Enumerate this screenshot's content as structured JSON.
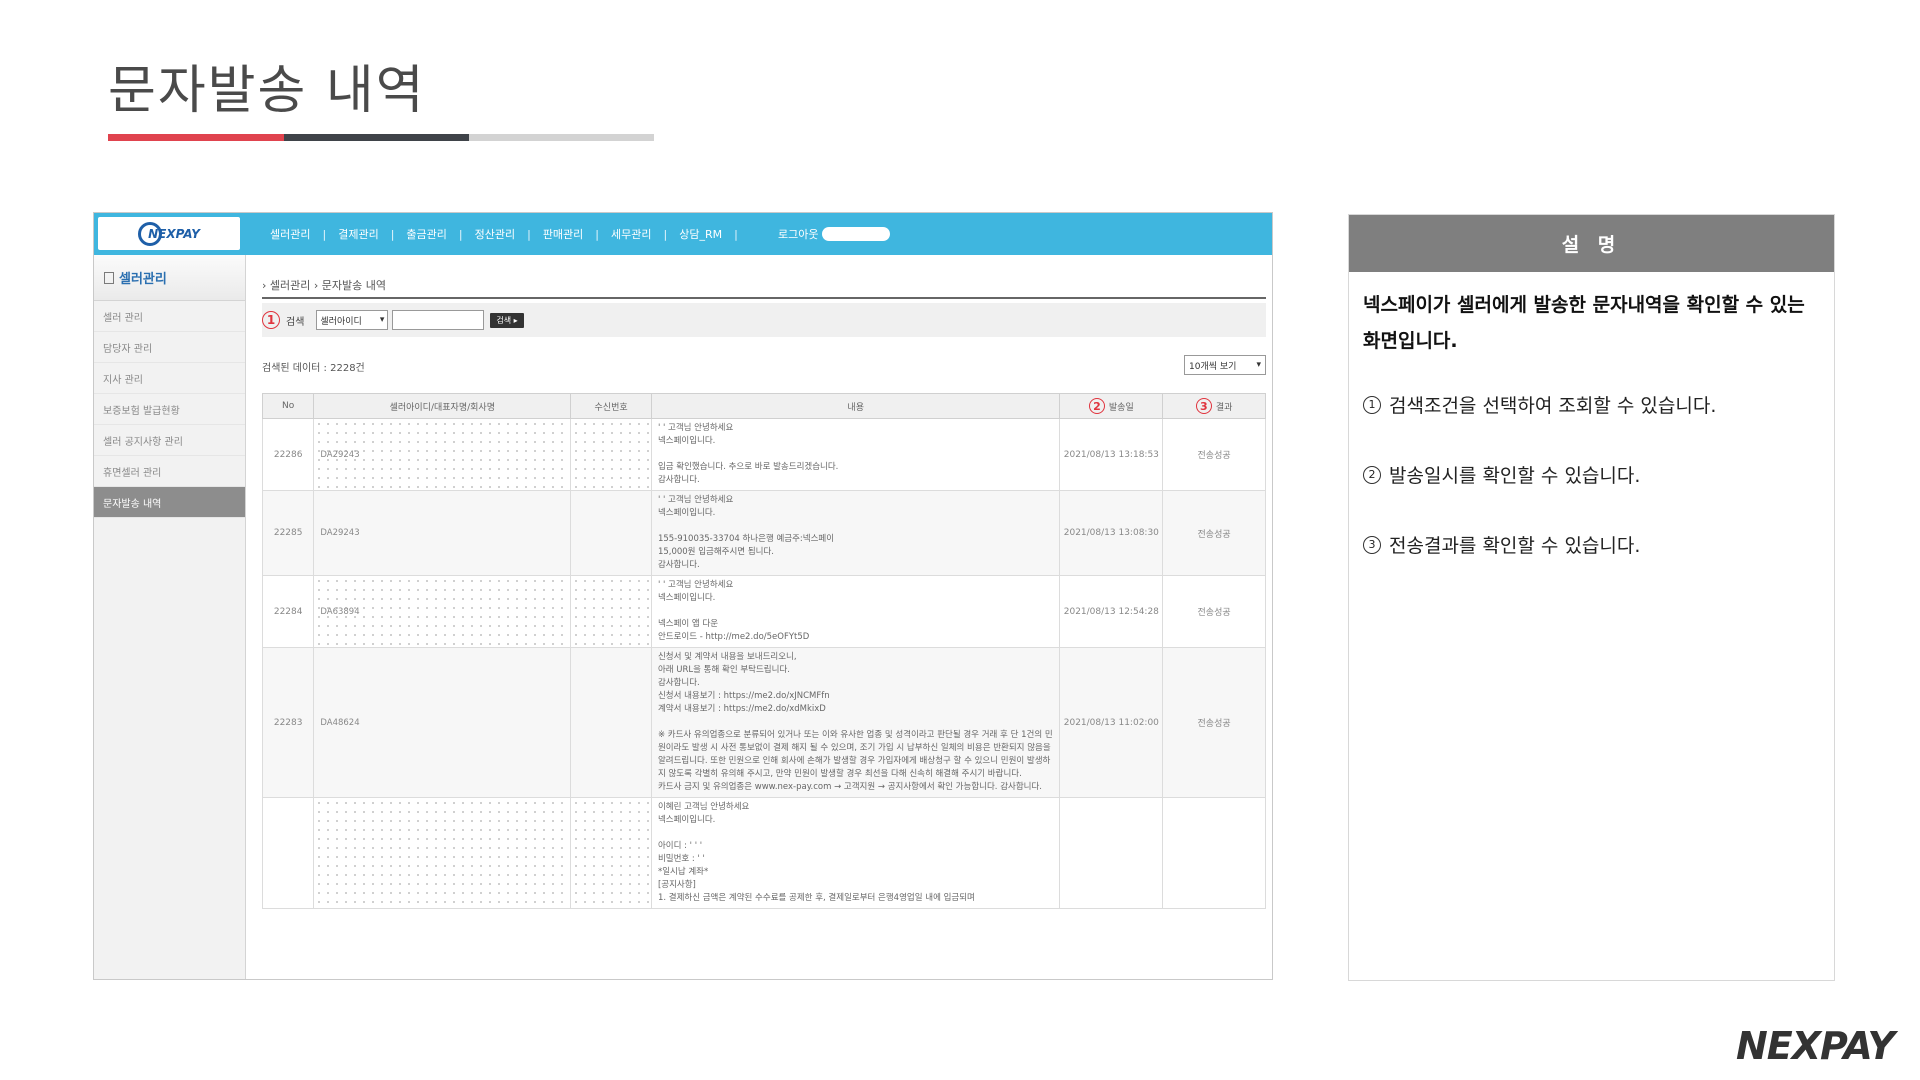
{
  "page": {
    "title": "문자발송 내역",
    "brand": "NEXPAY"
  },
  "app": {
    "logo_text": "NEXPAY",
    "nav": [
      "셀러관리",
      "결제관리",
      "출금관리",
      "정산관리",
      "판매관리",
      "세무관리",
      "상담_RM"
    ],
    "nav_separator": "|",
    "logout_label": "로그아웃"
  },
  "sidebar": {
    "header": "셀러관리",
    "items": [
      "셀러 관리",
      "담당자 관리",
      "지사 관리",
      "보증보험 발급현황",
      "셀러 공지사항 관리",
      "휴면셀러 관리",
      "문자발송 내역"
    ],
    "active_index": 6
  },
  "content": {
    "breadcrumb": "› 셀러관리 › 문자발송 내역",
    "search": {
      "marker": "1",
      "label": "검색",
      "select_value": "셀러아이디",
      "input_value": "",
      "button_label": "검색 ▸"
    },
    "result_count": "검색된 데이터 : 2228건",
    "per_page": "10개씩 보기",
    "table": {
      "columns": [
        "No",
        "셀러아이디/대표자명/회사명",
        "수신번호",
        "내용",
        "발송일",
        "결과"
      ],
      "date_marker": "2",
      "result_marker": "3",
      "rows": [
        {
          "no": "22286",
          "seller": "DA29243",
          "message": "' ' 고객님 안녕하세요\n넥스페이입니다.\n\n입금 확인했습니다. 추으로 바로 발송드리겠습니다.\n감사합니다.",
          "date": "2021/08/13 13:18:53",
          "result": "전송성공"
        },
        {
          "no": "22285",
          "seller": "DA29243",
          "message": "' ' 고객님 안녕하세요\n넥스페이입니다.\n\n155-910035-33704 하나은행 예금주:넥스페이\n15,000원 입금해주시면 됩니다.\n감사합니다.",
          "date": "2021/08/13 13:08:30",
          "result": "전송성공"
        },
        {
          "no": "22284",
          "seller": "DA63894",
          "message": "' ' 고객님 안녕하세요\n넥스페이입니다.\n\n넥스페이 앱 다운\n안드로이드 - http://me2.do/5eOFYt5D",
          "date": "2021/08/13 12:54:28",
          "result": "전송성공"
        },
        {
          "no": "22283",
          "seller": "DA48624",
          "message": "신청서 및 계약서 내용을 보내드리오니,\n아래 URL을 통해 확인 부탁드립니다.\n감사합니다.\n신청서 내용보기 : https://me2.do/xJNCMFfn\n계약서 내용보기 : https://me2.do/xdMkixD\n\n※ 카드사 유의업종으로 분류되어 있거나 또는 이와 유사한 업종 및 성격이라고 판단될 경우 거래 후 단 1건의 민원이라도 발생 시 사전 통보없이 결제 해지 될 수 있으며, 조기 가입 시 납부하신 일체의 비용은 반환되지 않음을 알려드립니다. 또한 민원으로 인해 회사에 손해가 발생할 경우 가입자에게 배상청구 할 수 있으니 민원이 발생하지 않도록 각별히 유의해 주시고, 만약 민원이 발생할 경우 최선을 다해 신속히 해결해 주시기 바랍니다.\n카드사 금지 및 유의업종은 www.nex-pay.com → 고객지원 → 공지사항에서 확인 가능합니다. 감사합니다.",
          "date": "2021/08/13 11:02:00",
          "result": "전송성공"
        },
        {
          "no": "",
          "seller": "",
          "message": "이혜린 고객님 안녕하세요\n넥스페이입니다.\n\n아이디 : ' ' '\n비밀번호 : ' '\n*일시납 계좌*\n[공지사항]\n1. 결제하신 금액은 계약된 수수료를 공제한 후, 결제일로부터 은행4영업일 내에 입금되며",
          "date": "",
          "result": ""
        }
      ]
    }
  },
  "description": {
    "header": "설 명",
    "intro": "넥스페이가 셀러에게 발송한 문자내역을 확인할 수 있는 화면입니다.",
    "points": [
      {
        "num": "1",
        "text": "검색조건을 선택하여 조회할 수 있습니다."
      },
      {
        "num": "2",
        "text": "발송일시를 확인할 수 있습니다."
      },
      {
        "num": "3",
        "text": "전송결과를 확인할 수 있습니다."
      }
    ]
  },
  "colors": {
    "nav_blue": "#3fb6df",
    "marker_red": "#e0343e",
    "accent_red": "#e0434e",
    "accent_dark": "#3f4349",
    "panel_gray": "#7f7f7f"
  }
}
